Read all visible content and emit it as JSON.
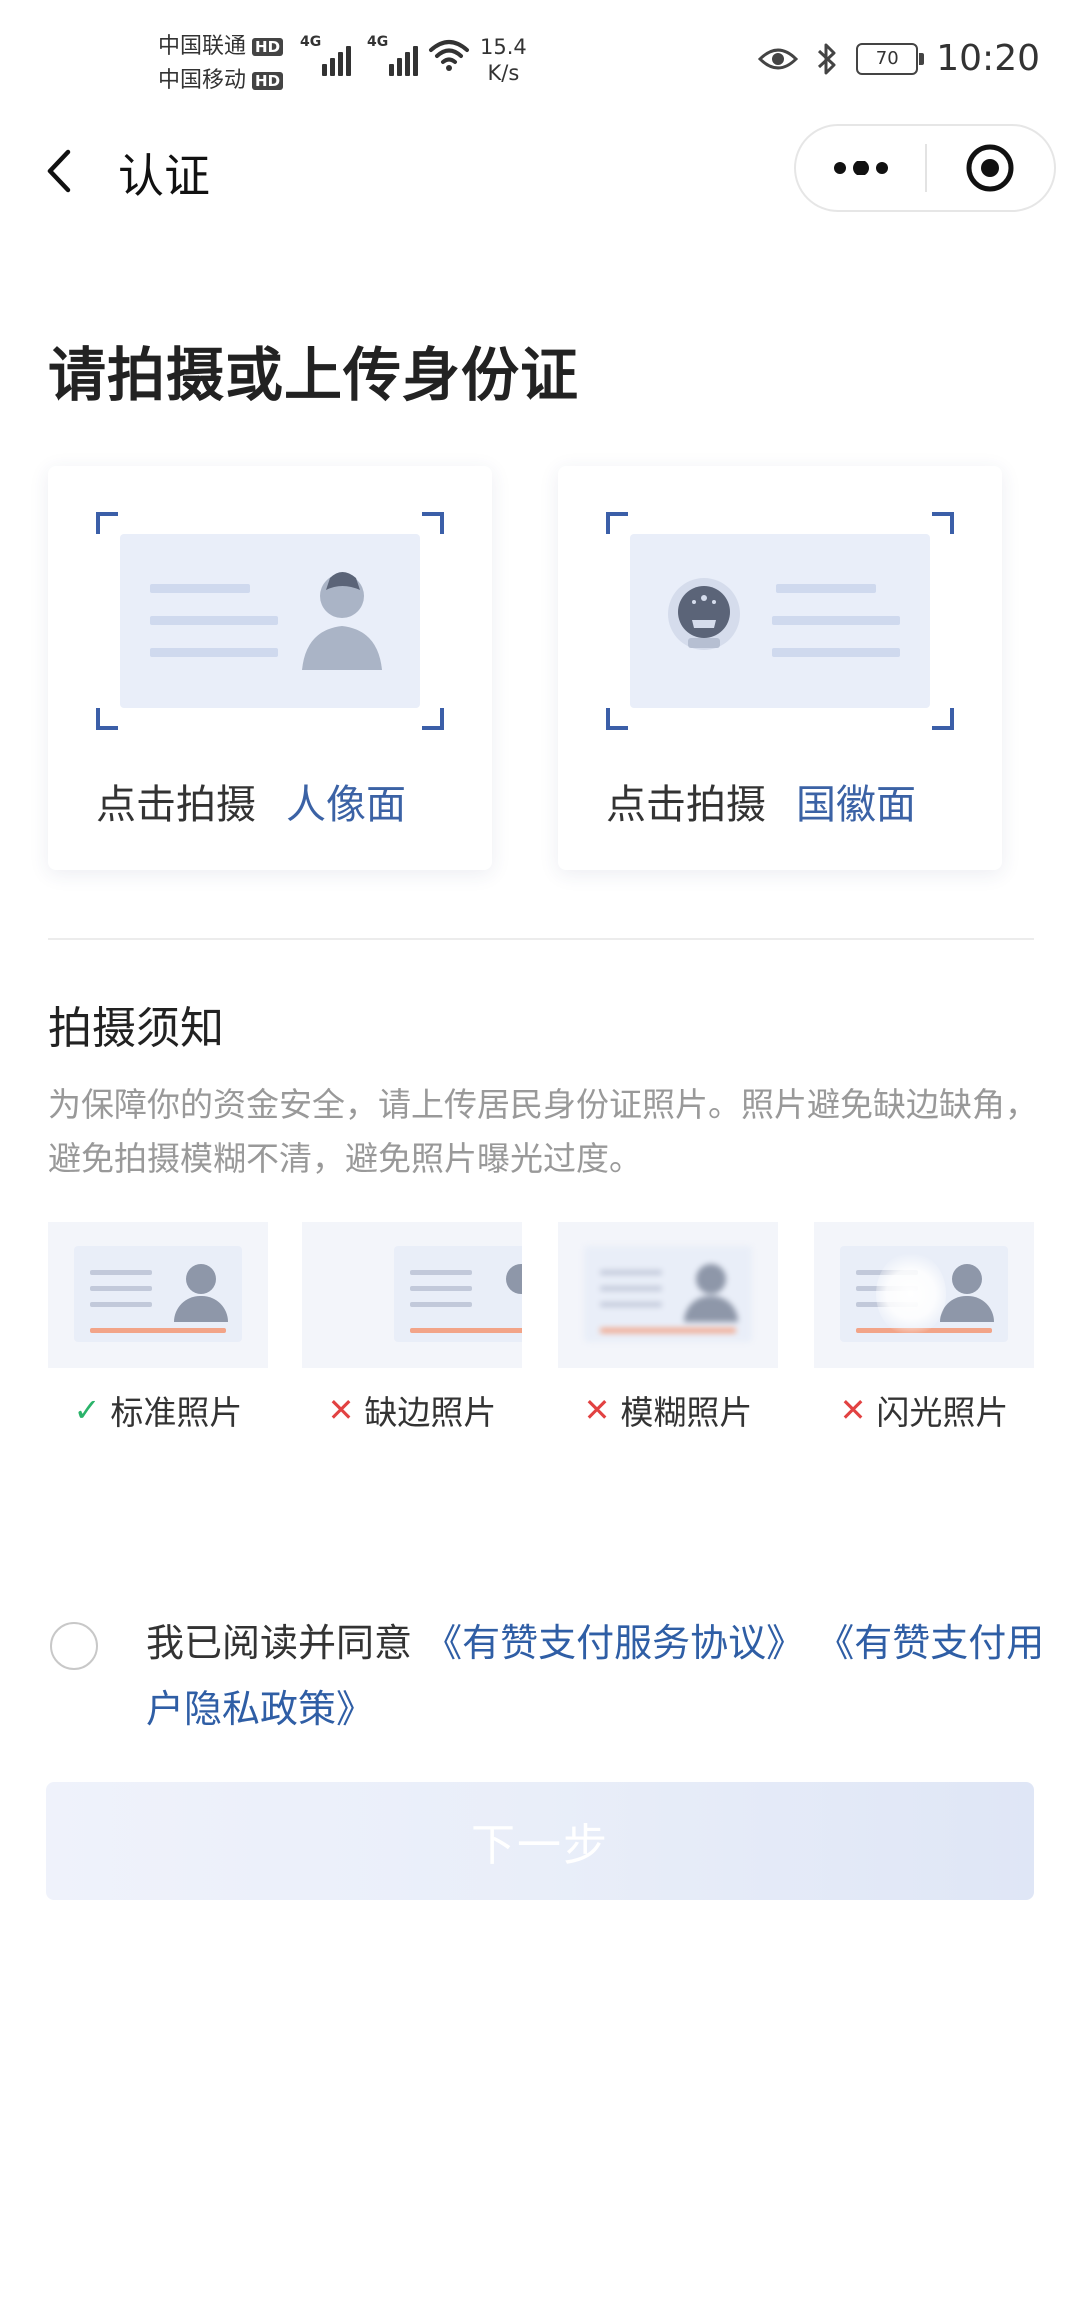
{
  "status_bar": {
    "carrier1": "中国联通",
    "carrier2": "中国移动",
    "hd": "HD",
    "network": "4G",
    "speed_value": "15.4",
    "speed_unit": "K/s",
    "battery": "70",
    "time": "10:20"
  },
  "nav": {
    "title": "认证"
  },
  "page_title": "请拍摄或上传身份证",
  "cards": [
    {
      "prefix": "点击拍摄",
      "side": "人像面"
    },
    {
      "prefix": "点击拍摄",
      "side": "国徽面"
    }
  ],
  "notice": {
    "title": "拍摄须知",
    "text": "为保障你的资金安全，请上传居民身份证照片。照片避免缺边缺角，避免拍摄模糊不清，避免照片曝光过度。"
  },
  "examples": [
    {
      "label": "标准照片",
      "icon": "✓",
      "status": "ok"
    },
    {
      "label": "缺边照片",
      "icon": "✕",
      "status": "bad"
    },
    {
      "label": "模糊照片",
      "icon": "✕",
      "status": "bad"
    },
    {
      "label": "闪光照片",
      "icon": "✕",
      "status": "bad"
    }
  ],
  "agreement": {
    "prefix": "我已阅读并同意",
    "link1": "《有赞支付服务协议》",
    "link2": "《有赞支付用户隐私政策》"
  },
  "next_button": "下一步",
  "colors": {
    "accent": "#3b62a5",
    "link": "#2f5ea5",
    "ok": "#2bb36a",
    "bad": "#e24242"
  }
}
